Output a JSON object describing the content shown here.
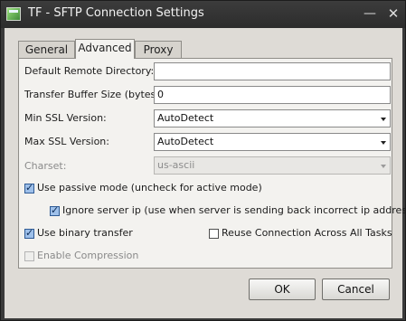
{
  "window": {
    "title": "TF - SFTP Connection Settings"
  },
  "controls": {
    "minimize": "—",
    "close": "✕"
  },
  "tabs": [
    {
      "label": "General"
    },
    {
      "label": "Advanced"
    },
    {
      "label": "Proxy"
    }
  ],
  "form": {
    "remote_dir_label": "Default Remote Directory:",
    "remote_dir_value": "",
    "buffer_label": "Transfer Buffer Size (bytes):",
    "buffer_value": "0",
    "min_ssl_label": "Min SSL Version:",
    "min_ssl_value": "AutoDetect",
    "max_ssl_label": "Max SSL Version:",
    "max_ssl_value": "AutoDetect",
    "charset_label": "Charset:",
    "charset_value": "us-ascii",
    "passive_label": "Use passive mode (uncheck for active mode)",
    "passive_checked": true,
    "ignore_ip_label": "Ignore server ip (use when server is sending back incorrect ip address)",
    "ignore_ip_checked": true,
    "binary_label": "Use binary transfer",
    "binary_checked": true,
    "reuse_label": "Reuse Connection Across All Tasks",
    "reuse_checked": false,
    "compression_label": "Enable Compression",
    "compression_checked": false
  },
  "buttons": {
    "ok": "OK",
    "cancel": "Cancel"
  }
}
